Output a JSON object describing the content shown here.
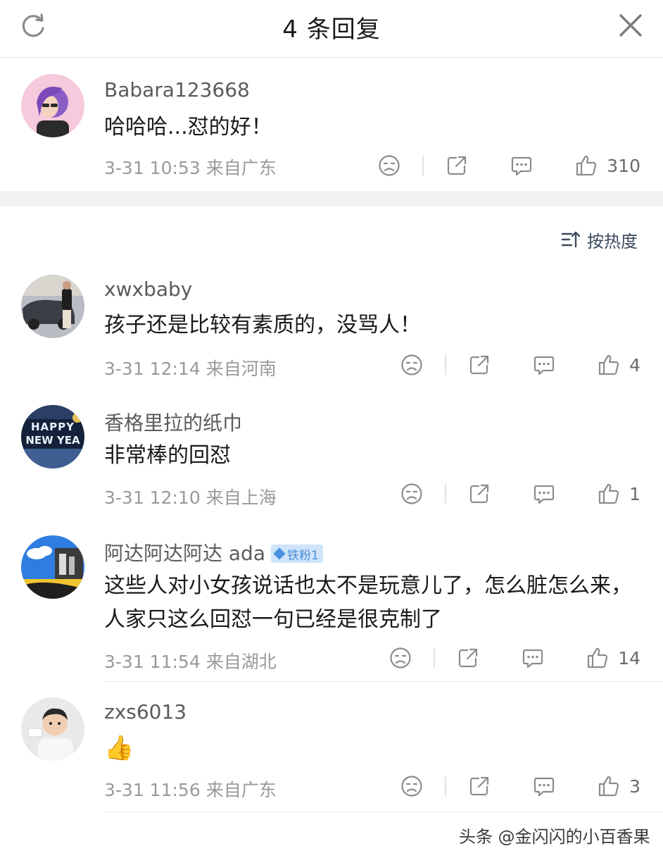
{
  "header": {
    "title": "4 条回复",
    "refresh_icon": "refresh-icon",
    "close_icon": "close-icon"
  },
  "main_comment": {
    "user": "Babara123668",
    "text": "哈哈哈...怼的好！",
    "time": "3-31 10:53",
    "location": "来自广东",
    "likes": "310"
  },
  "sort": {
    "label": "按热度",
    "icon": "sort-icon"
  },
  "replies": [
    {
      "user": "xwxbaby",
      "text": "孩子还是比较有素质的，没骂人！",
      "time": "3-31 12:14",
      "location": "来自河南",
      "likes": "4"
    },
    {
      "user": "香格里拉的纸巾",
      "text": "非常棒的回怼",
      "time": "3-31 12:10",
      "location": "来自上海",
      "likes": "1"
    },
    {
      "user": "阿达阿达阿达 ada",
      "badge": "铁粉1",
      "text": "这些人对小女孩说话也太不是玩意儿了，怎么脏怎么来，人家只这么回怼一句已经是很克制了",
      "time": "3-31 11:54",
      "location": "来自湖北",
      "likes": "14"
    },
    {
      "user": "zxs6013",
      "text": "👍",
      "time": "3-31 11:56",
      "location": "来自广东",
      "likes": "3"
    }
  ],
  "avatar_art": {
    "babara": "HAPPY NEW YEA"
  },
  "watermark": "头条 @金闪闪的小百香果",
  "colors": {
    "badge_bg": "#cfe4fb",
    "badge_text": "#4a8fd6",
    "separator": "#f2f2f2"
  }
}
